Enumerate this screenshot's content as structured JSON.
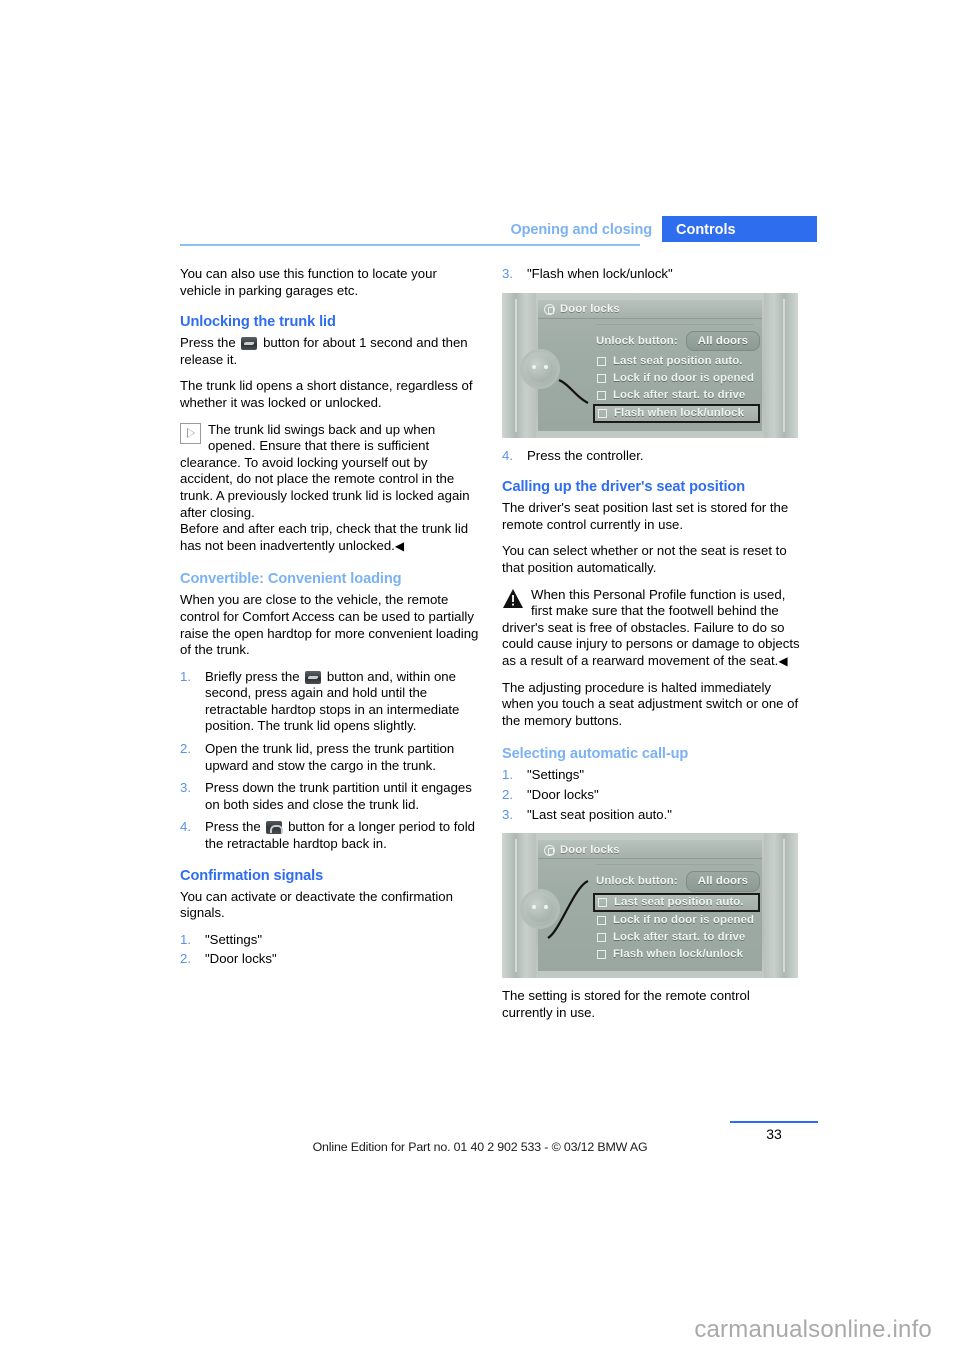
{
  "header": {
    "chapter": "Opening and closing",
    "section": "Controls"
  },
  "left_column": {
    "intro": "You can also use this function to locate your vehicle in parking garages etc.",
    "heading_unlocking": "Unlocking the trunk lid",
    "press_button_1": "Press the",
    "press_button_2": "button for about 1 second and then release it.",
    "trunk_opens": "The trunk lid opens a short distance, regardless of whether it was locked or unlocked.",
    "note_text": "The trunk lid swings back and up when opened. Ensure that there is sufficient clearance. To avoid locking yourself out by accident, do not place the remote control in the trunk. A previously locked trunk lid is locked again after closing.",
    "note_text2": "Before and after each trip, check that the trunk lid has not been inadvertently unlocked.",
    "note_end_mark": "◀",
    "heading_convertible": "Convertible: Convenient loading",
    "convertible_intro": "When you are close to the vehicle, the remote control for Comfort Access can be used to partially raise the open hardtop for more convenient loading of the trunk.",
    "steps": [
      {
        "num": "1.",
        "text_before": "Briefly press the",
        "text_after": "button and, within one second, press again and hold until the retractable hardtop stops in an intermediate position. The trunk lid opens slightly.",
        "icon": "trunk-button-icon"
      },
      {
        "num": "2.",
        "text_before": "",
        "text_after": "Open the trunk lid, press the trunk partition upward and stow the cargo in the trunk.",
        "icon": ""
      },
      {
        "num": "3.",
        "text_before": "",
        "text_after": "Press down the trunk partition until it engages on both sides and close the trunk lid.",
        "icon": ""
      },
      {
        "num": "4.",
        "text_before": "Press the",
        "text_after": "button for a longer period to fold the retractable hardtop back in.",
        "icon": "hardtop-button-icon"
      }
    ],
    "heading_confirmation": "Confirmation signals",
    "confirmation_intro": "You can activate or deactivate the confirmation signals.",
    "confirmation_steps": [
      {
        "num": "1.",
        "text": "\"Settings\""
      },
      {
        "num": "2.",
        "text": "\"Door locks\""
      }
    ]
  },
  "right_column": {
    "step3": {
      "num": "3.",
      "text": "\"Flash when lock/unlock\""
    },
    "idrive_1": {
      "title": "Door locks",
      "unlock_label": "Unlock button:",
      "unlock_value": "All doors",
      "items": [
        {
          "label": "Last seat position auto.",
          "selected": false
        },
        {
          "label": "Lock if no door is opened",
          "selected": false
        },
        {
          "label": "Lock after start. to drive",
          "selected": false
        },
        {
          "label": "Flash when lock/unlock",
          "selected": true
        }
      ]
    },
    "step4": {
      "num": "4.",
      "text": "Press the controller."
    },
    "heading_calling": "Calling up the driver's seat position",
    "calling_p1": "The driver's seat position last set is stored for the remote control currently in use.",
    "calling_p2": "You can select whether or not the seat is reset to that position automatically.",
    "warning_text": "When this Personal Profile function is used, first make sure that the footwell behind the driver's seat is free of obstacles. Failure to do so could cause injury to persons or damage to objects as a result of a rearward movement of the seat.",
    "warning_end_mark": "◀",
    "calling_p3": "The adjusting procedure is halted immediately when you touch a seat adjustment switch or one of the memory buttons.",
    "heading_selecting": "Selecting automatic call-up",
    "selecting_steps": [
      {
        "num": "1.",
        "text": "\"Settings\""
      },
      {
        "num": "2.",
        "text": "\"Door locks\""
      },
      {
        "num": "3.",
        "text": "\"Last seat position auto.\""
      }
    ],
    "idrive_2": {
      "title": "Door locks",
      "unlock_label": "Unlock button:",
      "unlock_value": "All doors",
      "items": [
        {
          "label": "Last seat position auto.",
          "selected": true
        },
        {
          "label": "Lock if no door is opened",
          "selected": false
        },
        {
          "label": "Lock after start. to drive",
          "selected": false
        },
        {
          "label": "Flash when lock/unlock",
          "selected": false
        }
      ]
    },
    "closing_text": "The setting is stored for the remote control currently in use."
  },
  "footer": {
    "edition": "Online Edition for Part no. 01 40 2 902 533 - © 03/12 BMW AG",
    "page_number": "33"
  },
  "watermark": "carmanualsonline.info",
  "colors": {
    "accent_blue": "#2f6def",
    "light_blue": "#7cb2f2",
    "number_blue": "#5b92e8"
  }
}
